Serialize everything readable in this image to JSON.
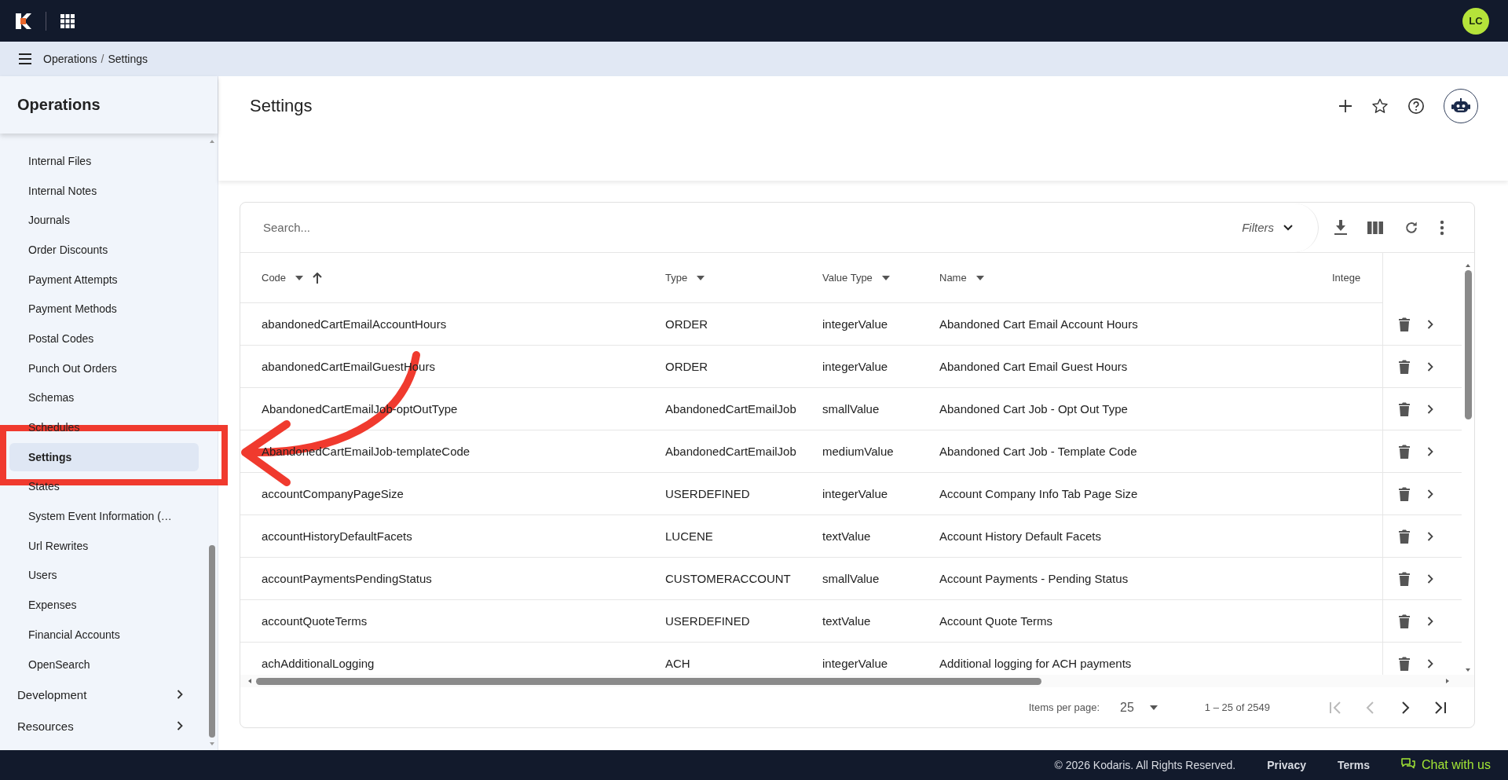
{
  "top_bar": {
    "avatar_initials": "LC"
  },
  "breadcrumb": {
    "items": [
      "Operations",
      "Settings"
    ],
    "separator": "/"
  },
  "sidebar": {
    "title": "Operations",
    "items": [
      {
        "label": "Internal Files",
        "kind": "link",
        "selected": false
      },
      {
        "label": "Internal Notes",
        "kind": "link",
        "selected": false
      },
      {
        "label": "Journals",
        "kind": "link",
        "selected": false
      },
      {
        "label": "Order Discounts",
        "kind": "link",
        "selected": false
      },
      {
        "label": "Payment Attempts",
        "kind": "link",
        "selected": false
      },
      {
        "label": "Payment Methods",
        "kind": "link",
        "selected": false
      },
      {
        "label": "Postal Codes",
        "kind": "link",
        "selected": false
      },
      {
        "label": "Punch Out Orders",
        "kind": "link",
        "selected": false
      },
      {
        "label": "Schemas",
        "kind": "link",
        "selected": false
      },
      {
        "label": "Schedules",
        "kind": "link",
        "selected": false
      },
      {
        "label": "Settings",
        "kind": "link",
        "selected": true
      },
      {
        "label": "States",
        "kind": "link",
        "selected": false
      },
      {
        "label": "System Event Information (…",
        "kind": "link",
        "selected": false
      },
      {
        "label": "Url Rewrites",
        "kind": "link",
        "selected": false
      },
      {
        "label": "Users",
        "kind": "link",
        "selected": false
      },
      {
        "label": "Expenses",
        "kind": "link",
        "selected": false
      },
      {
        "label": "Financial Accounts",
        "kind": "link",
        "selected": false
      },
      {
        "label": "OpenSearch",
        "kind": "link",
        "selected": false
      },
      {
        "label": "Development",
        "kind": "group",
        "selected": false
      },
      {
        "label": "Resources",
        "kind": "group",
        "selected": false
      }
    ]
  },
  "page": {
    "title": "Settings"
  },
  "table": {
    "search": {
      "placeholder": "Search..."
    },
    "filters_label": "Filters",
    "columns": [
      {
        "label": "Code",
        "menu": true,
        "sorted_ascending": true
      },
      {
        "label": "Type",
        "menu": true,
        "sorted_ascending": false
      },
      {
        "label": "Value Type",
        "menu": true,
        "sorted_ascending": false
      },
      {
        "label": "Name",
        "menu": true,
        "sorted_ascending": false
      },
      {
        "label": "Intege",
        "menu": false,
        "sorted_ascending": false
      }
    ],
    "rows": [
      {
        "code": "abandonedCartEmailAccountHours",
        "type": "ORDER",
        "value_type": "integerValue",
        "name": "Abandoned Cart Email Account Hours"
      },
      {
        "code": "abandonedCartEmailGuestHours",
        "type": "ORDER",
        "value_type": "integerValue",
        "name": "Abandoned Cart Email Guest Hours"
      },
      {
        "code": "AbandonedCartEmailJob-optOutType",
        "type": "AbandonedCartEmailJob",
        "value_type": "smallValue",
        "name": "Abandoned Cart Job - Opt Out Type"
      },
      {
        "code": "AbandonedCartEmailJob-templateCode",
        "type": "AbandonedCartEmailJob",
        "value_type": "mediumValue",
        "name": "Abandoned Cart Job - Template Code"
      },
      {
        "code": "accountCompanyPageSize",
        "type": "USERDEFINED",
        "value_type": "integerValue",
        "name": "Account Company Info Tab Page Size"
      },
      {
        "code": "accountHistoryDefaultFacets",
        "type": "LUCENE",
        "value_type": "textValue",
        "name": "Account History Default Facets"
      },
      {
        "code": "accountPaymentsPendingStatus",
        "type": "CUSTOMERACCOUNT",
        "value_type": "smallValue",
        "name": "Account Payments - Pending Status"
      },
      {
        "code": "accountQuoteTerms",
        "type": "USERDEFINED",
        "value_type": "textValue",
        "name": "Account Quote Terms"
      },
      {
        "code": "achAdditionalLogging",
        "type": "ACH",
        "value_type": "integerValue",
        "name": "Additional logging for ACH payments"
      }
    ]
  },
  "pagination": {
    "items_per_page_label": "Items per page:",
    "page_size": "25",
    "range": "1 – 25 of 2549",
    "first_disabled": true,
    "previous_disabled": true,
    "next_disabled": false,
    "last_disabled": false
  },
  "footer": {
    "copyright": "© 2026 Kodaris. All Rights Reserved.",
    "links": [
      "Privacy",
      "Terms"
    ],
    "chat": "Chat with us"
  }
}
